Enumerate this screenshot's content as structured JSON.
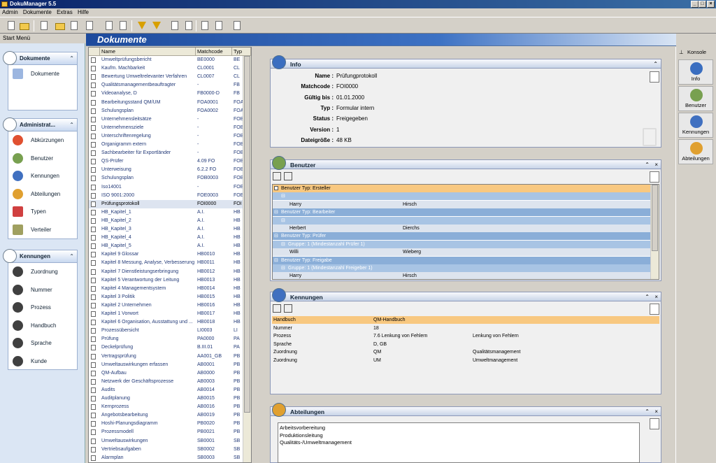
{
  "window": {
    "title": "DokuManager 5.5"
  },
  "menu": [
    "Admin",
    "Dokumente",
    "Extras",
    "Hilfe"
  ],
  "start_menu_label": "Start Menü",
  "header_title": "Dokumente",
  "sidebar": {
    "groups": [
      {
        "title": "Dokumente",
        "items": [
          "Dokumente"
        ]
      },
      {
        "title": "Administrat...",
        "items": [
          "Abkürzungen",
          "Benutzer",
          "Kennungen",
          "Abteilungen",
          "Typen",
          "Verteiler"
        ]
      },
      {
        "title": "Kennungen",
        "items": [
          "Zuordnung",
          "Nummer",
          "Prozess",
          "Handbuch",
          "Sprache",
          "Kunde"
        ]
      }
    ]
  },
  "doclist": {
    "columns": [
      "Name",
      "Matchcode",
      "Typ"
    ],
    "rows": [
      [
        "Umweltprüfungsbericht",
        "BE0000",
        "BE"
      ],
      [
        "Kaufm. Machbarkeit",
        "CL0001",
        "CL"
      ],
      [
        "Bewertung Umweltrelevanter Verfahren",
        "CL0007",
        "CL"
      ],
      [
        "Qualitätsmanagementbeauftragter",
        "-",
        "FB"
      ],
      [
        "Videoanalyse, D",
        "FB0000-D",
        "FB"
      ],
      [
        "Bearbeitungsstand QM/UM",
        "FOA0001",
        "FOA"
      ],
      [
        "Schulungsplan",
        "FOA0002",
        "FOA"
      ],
      [
        "Unternehmensleitsätze",
        "-",
        "FOB"
      ],
      [
        "Unternehmensziele",
        "-",
        "FOB"
      ],
      [
        "Unterschriftenregelung",
        "-",
        "FOB"
      ],
      [
        "Organigramm extern",
        "-",
        "FOB"
      ],
      [
        "Sachbearbeiter für Exportländer",
        "-",
        "FOB"
      ],
      [
        "QS-Prüfer",
        "4.09 FO",
        "FOB"
      ],
      [
        "Unterweisung",
        "6.2.2 FO",
        "FOB"
      ],
      [
        "Schulungsplan",
        "FOB0003",
        "FOB"
      ],
      [
        "Iso14001",
        "-",
        "FOE"
      ],
      [
        "ISO 9001:2000",
        "FOE0003",
        "FOE"
      ],
      [
        "Prüfungsprotokoll",
        "FOI0000",
        "FOI"
      ],
      [
        "HB_Kapitel_1",
        "A.I.",
        "HB"
      ],
      [
        "HB_Kapitel_2",
        "A.I.",
        "HB"
      ],
      [
        "HB_Kapitel_3",
        "A.I.",
        "HB"
      ],
      [
        "HB_Kapitel_4",
        "A.I.",
        "HB"
      ],
      [
        "HB_Kapitel_5",
        "A.I.",
        "HB"
      ],
      [
        "Kapitel 9 Glossar",
        "HB0010",
        "HB"
      ],
      [
        "Kapitel 8 Messung, Analyse, Verbesserung",
        "HB0011",
        "HB"
      ],
      [
        "Kapitel 7 Dienstleistungserbringung",
        "HB0012",
        "HB"
      ],
      [
        "Kapitel 5 Verantwortung der Leitung",
        "HB0013",
        "HB"
      ],
      [
        "Kapitel 4 Managementsystem",
        "HB0014",
        "HB"
      ],
      [
        "Kapitel 3 Politik",
        "HB0015",
        "HB"
      ],
      [
        "Kapitel 2 Unternehmen",
        "HB0016",
        "HB"
      ],
      [
        "Kapitel 1 Vorwort",
        "HB0017",
        "HB"
      ],
      [
        "Kapitel 6 Organisation, Ausstattung und ...",
        "HB0018",
        "HB"
      ],
      [
        "Prozessübersicht",
        "LI0003",
        "LI"
      ],
      [
        "Prüfung",
        "PA0000",
        "PA"
      ],
      [
        "Deckelprüfung",
        "B.III.01",
        "PA"
      ],
      [
        "Vertragsprüfung",
        "AA001_GB",
        "PB"
      ],
      [
        "Umweltauswirkungen erfassen",
        "AB0001",
        "PB"
      ],
      [
        "QM-Aufbau",
        "AB0000",
        "PB"
      ],
      [
        "Netzwerk der Geschäftsprozesse",
        "AB0003",
        "PB"
      ],
      [
        "Audits",
        "AB0014",
        "PB"
      ],
      [
        "Auditplanung",
        "AB0015",
        "PB"
      ],
      [
        "Kernprozess",
        "AB0016",
        "PB"
      ],
      [
        "Angebotsbearbeitung",
        "AB0019",
        "PB"
      ],
      [
        "Hoshi-Planungsdiagramm",
        "PB0020",
        "PB"
      ],
      [
        "Prozessmodell",
        "PB0021",
        "PB"
      ],
      [
        "Umweltauswirkungen",
        "SB0001",
        "SB"
      ],
      [
        "Vertriebsaufgaben",
        "SB0002",
        "SB"
      ],
      [
        "Alarmplan",
        "SB0003",
        "SB"
      ]
    ],
    "selected_row": 17
  },
  "info": {
    "title": "Info",
    "fields": [
      {
        "label": "Name :",
        "value": "Prüfungprotokoll"
      },
      {
        "label": "Matchcode :",
        "value": "FOI0000"
      },
      {
        "label": "Gültig bis :",
        "value": "01.01.2000"
      },
      {
        "label": "Typ :",
        "value": "Formular intern"
      },
      {
        "label": "Status :",
        "value": "Freigegeben"
      },
      {
        "label": "Version :",
        "value": "1"
      },
      {
        "label": "Dateigröße :",
        "value": "48 KB"
      }
    ]
  },
  "benutzer": {
    "title": "Benutzer",
    "rows": [
      {
        "kind": "group-orange",
        "text": "Benutzer Typ: Ersteller"
      },
      {
        "kind": "sub",
        "text": ""
      },
      {
        "kind": "user",
        "name": "Harry",
        "last": "Hirsch"
      },
      {
        "kind": "group",
        "text": "Benutzer Typ: Bearbeiter"
      },
      {
        "kind": "sub",
        "text": ""
      },
      {
        "kind": "user",
        "name": "Herbert",
        "last": "Dierchs"
      },
      {
        "kind": "group",
        "text": "Benutzer Typ: Prüfer"
      },
      {
        "kind": "sub",
        "text": "Gruppe: 1 (Mindestanzahl Prüfer 1)"
      },
      {
        "kind": "user",
        "name": "Willi",
        "last": "Wieberg"
      },
      {
        "kind": "group",
        "text": "Benutzer Typ: Freigabe"
      },
      {
        "kind": "sub",
        "text": "Gruppe: 1 (Mindestanzahl Freigeber 1)"
      },
      {
        "kind": "user",
        "name": "Harry",
        "last": "Hirsch"
      }
    ]
  },
  "kennungen": {
    "title": "Kennungen",
    "rows": [
      [
        "Handbuch",
        "QM-Handbuch",
        ""
      ],
      [
        "Nummer",
        "18",
        ""
      ],
      [
        "Prozess",
        "7.6 Lenkung von Fehlern",
        "Lenkung von Fehlern"
      ],
      [
        "Sprache",
        "D, GB",
        ""
      ],
      [
        "Zuordnung",
        "QM",
        "Qualitätsmanagement"
      ],
      [
        "Zuordnung",
        "UM",
        "Umweltmanagement"
      ]
    ]
  },
  "abteilungen": {
    "title": "Abteilungen",
    "items": [
      "Arbeitsvorbereitung",
      "Produktionsleitung",
      "Qualitäts-/Umweltmanagement"
    ]
  },
  "konsole": {
    "title": "Konsole",
    "buttons": [
      "Info",
      "Benutzer",
      "Kennungen",
      "Abteilungen"
    ]
  }
}
